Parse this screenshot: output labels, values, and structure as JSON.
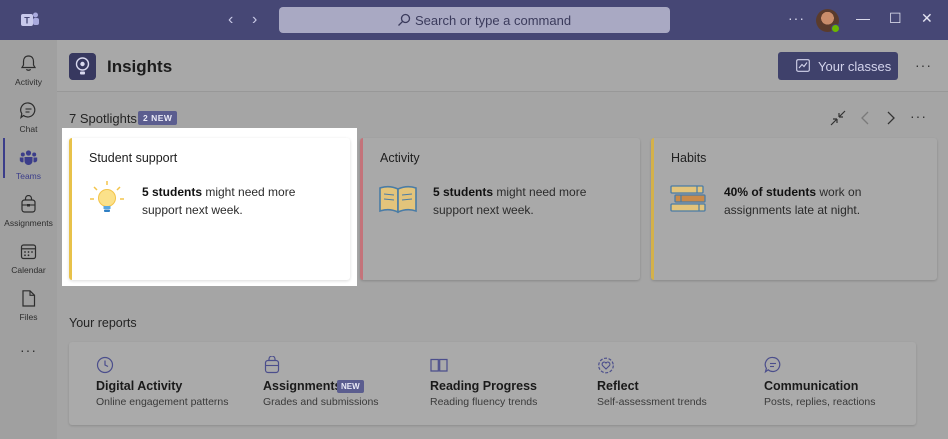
{
  "titlebar": {
    "search_placeholder": "Search or type a command",
    "more": "···",
    "back_arrow": "‹",
    "forward_arrow": "›",
    "minimize": "—",
    "maximize": "☐",
    "close": "✕",
    "icons": [
      "teams-logo-icon",
      "search-icon",
      "avatar"
    ],
    "bar_color": "#464775"
  },
  "rail": {
    "items": [
      {
        "label": "Activity",
        "icon": "bell-icon"
      },
      {
        "label": "Chat",
        "icon": "chat-icon"
      },
      {
        "label": "Teams",
        "icon": "teams-icon",
        "active": true
      },
      {
        "label": "Assignments",
        "icon": "assignments-icon"
      },
      {
        "label": "Calendar",
        "icon": "calendar-icon"
      },
      {
        "label": "Files",
        "icon": "files-icon"
      }
    ],
    "more": "···"
  },
  "header": {
    "title": "Insights",
    "your_classes": "Your classes",
    "more": "···"
  },
  "spotlights": {
    "title": "7 Spotlights",
    "badge": "2 NEW",
    "cards": [
      {
        "title": "Student support",
        "bold": "5 students",
        "text": " might need more support next week.",
        "accent": "#e8c24a",
        "icon": "lightbulb-icon"
      },
      {
        "title": "Activity",
        "bold": "5 students",
        "text": " might need more support next week.",
        "accent": "#c4737a",
        "icon": "open-book-icon"
      },
      {
        "title": "Habits",
        "bold": "40% of students",
        "text": " work on assignments late at night.",
        "accent": "#d4b14a",
        "icon": "books-icon"
      }
    ]
  },
  "reports": {
    "title": "Your reports",
    "items": [
      {
        "name": "Digital Activity",
        "desc": "Online engagement patterns",
        "icon": "clock-icon"
      },
      {
        "name": "Assignments",
        "desc": "Grades and submissions",
        "badge": "NEW",
        "icon": "assignment-bag-icon"
      },
      {
        "name": "Reading Progress",
        "desc": "Reading fluency trends",
        "icon": "book-icon"
      },
      {
        "name": "Reflect",
        "desc": "Self-assessment trends",
        "icon": "heart-icon"
      },
      {
        "name": "Communication",
        "desc": "Posts, replies, reactions",
        "icon": "chat-bubble-icon"
      }
    ]
  }
}
